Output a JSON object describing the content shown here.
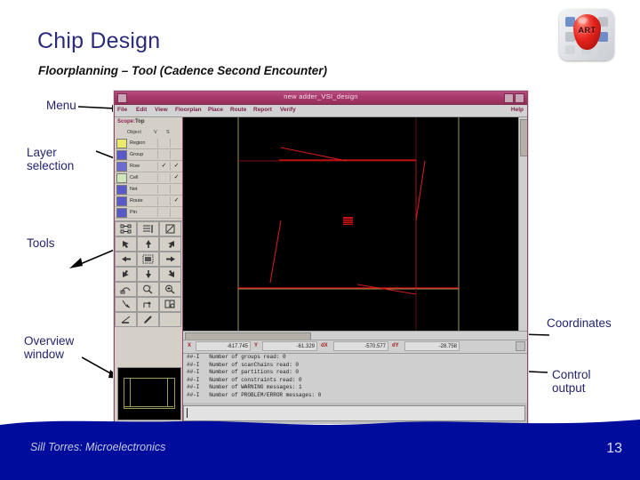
{
  "slide": {
    "title": "Chip Design",
    "subtitle": "Floorplanning – Tool (Cadence Second Encounter)",
    "footer": "Sill Torres: Microelectronics",
    "page_number": "13",
    "logo_text": "ART",
    "accent_color": "#24246e",
    "band_color": "#000d9c"
  },
  "annotations": {
    "menu": "Menu",
    "layer_selection": "Layer\nselection",
    "tools": "Tools",
    "overview_window": "Overview\nwindow",
    "coordinates": "Coordinates",
    "control_output": "Control\noutput"
  },
  "app": {
    "title": "new adder_VSI_design",
    "menu_items": [
      "File",
      "Edit",
      "View",
      "Floorplan",
      "Place",
      "Route",
      "Report",
      "Verify"
    ],
    "help_label": "Help",
    "scope": {
      "label": "Scope:",
      "value": "Top"
    },
    "layer_table": {
      "headers": [
        "Object",
        "V",
        "S"
      ],
      "rows": [
        {
          "name": "Region",
          "color": "#e9e96a",
          "v": "",
          "s": ""
        },
        {
          "name": "Group",
          "color": "#5858c8",
          "v": "",
          "s": ""
        },
        {
          "name": "Row",
          "color": "#6a6ad0",
          "v": "✓",
          "s": "✓"
        },
        {
          "name": "Cell",
          "color": "#cfe6b8",
          "v": "",
          "s": "✓"
        },
        {
          "name": "Net",
          "color": "#5858c8",
          "v": "",
          "s": ""
        },
        {
          "name": "Route",
          "color": "#5858c8",
          "v": "",
          "s": "✓"
        },
        {
          "name": "Pin",
          "color": "#5858c8",
          "v": "",
          "s": ""
        }
      ]
    },
    "tools": [
      [
        "hierarchy-icon",
        "list-icon",
        "edit-icon"
      ],
      [
        "arrow-up-left-icon",
        "arrow-up-icon",
        "arrow-up-right-icon"
      ],
      [
        "arrow-left-icon",
        "fit-icon",
        "arrow-right-icon"
      ],
      [
        "arrow-down-left-icon",
        "arrow-down-icon",
        "arrow-down-right-icon"
      ],
      [
        "undo-icon",
        "zoom-out-icon",
        "zoom-in-icon"
      ],
      [
        "ruler-icon",
        "route-icon",
        "book-icon"
      ],
      [
        "measure-icon",
        "pencil-icon",
        ""
      ]
    ],
    "coordinates": {
      "x_label": "X",
      "x_value": "-617.745",
      "y_label": "Y",
      "y_value": "-61.329",
      "dx_label": "dX",
      "dx_value": "-570.577",
      "dy_label": "dY",
      "dy_value": "-28.758"
    },
    "console_lines": [
      "##-I   Number of groups read: 0",
      "##-I   Number of scanChains read: 0",
      "##-I   Number of partitions read: 0",
      "##-I   Number of constraints read: 0",
      "##-I   Number of WARNING messages: 1",
      "##-I   Number of PROBLEM/ERROR messages: 0"
    ],
    "command_value": ""
  }
}
